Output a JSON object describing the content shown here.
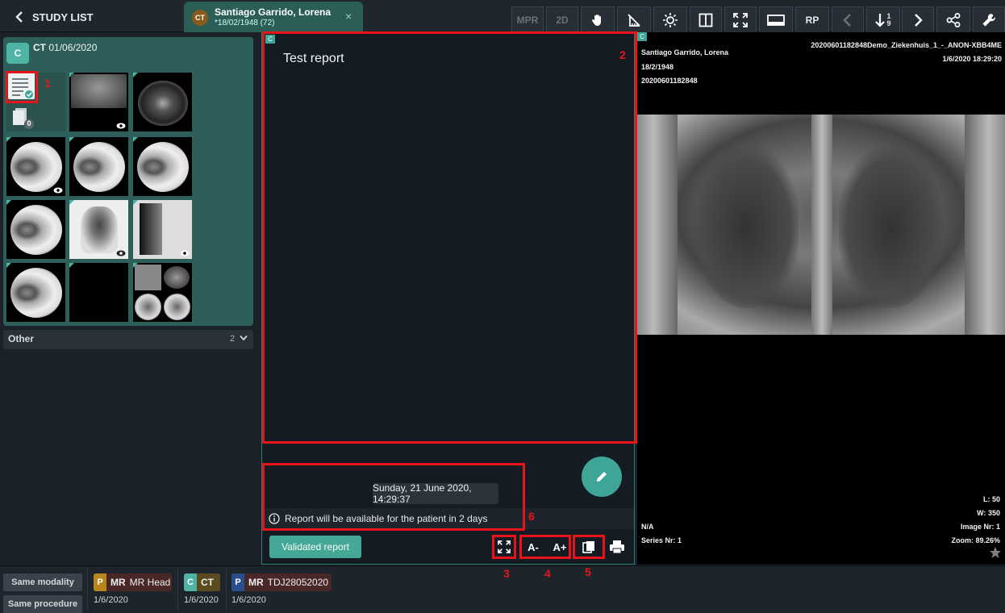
{
  "topbar": {
    "back_label": "STUDY LIST",
    "patient": {
      "modality": "CT",
      "name": "Santiago Garrido, Lorena",
      "dob": "*18/02/1948 (72)",
      "close": "×"
    },
    "tools": {
      "mpr": "MPR",
      "twod": "2D",
      "rp": "RP",
      "series_top": "1",
      "series_bottom": "9"
    }
  },
  "left": {
    "study": {
      "badge": "C",
      "modality": "CT",
      "date": "01/06/2020"
    },
    "report_count": "0",
    "other": {
      "label": "Other",
      "count": "2"
    }
  },
  "report": {
    "corner": "C",
    "text": "Test report",
    "date": "Sunday, 21 June 2020, 14:29:37",
    "availability": "Report will be available for the patient in 2 days",
    "validated_label": "Validated report",
    "font_decrease": "A-",
    "font_increase": "A+"
  },
  "viewer": {
    "corner": "C",
    "patient_name": "Santiago Garrido, Lorena",
    "dob": "18/2/1948",
    "patient_id": "20200601182848",
    "study_desc": "20200601182848Demo_Ziekenhuis_1_-_ANON-XBB4ME",
    "datetime": "1/6/2020 18:29:20",
    "level": "L: 50",
    "width": "W: 350",
    "image_nr": "Image Nr: 1",
    "zoom": "Zoom: 89.26%",
    "na": "N/A",
    "series_nr": "Series Nr: 1"
  },
  "bottom": {
    "same_modality": "Same modality",
    "same_procedure": "Same procedure",
    "priors": [
      {
        "badge": "P",
        "modality": "MR",
        "desc": "MR Head",
        "date": "1/6/2020",
        "color": "#b8861b"
      },
      {
        "badge": "C",
        "modality": "CT",
        "desc": "",
        "date": "1/6/2020",
        "color": "#4fb3a6"
      },
      {
        "badge": "P",
        "modality": "MR",
        "desc": "TDJ28052020",
        "date": "1/6/2020",
        "color": "#2a4f8f"
      }
    ]
  },
  "annotations": [
    "1",
    "2",
    "3",
    "4",
    "5",
    "6"
  ]
}
